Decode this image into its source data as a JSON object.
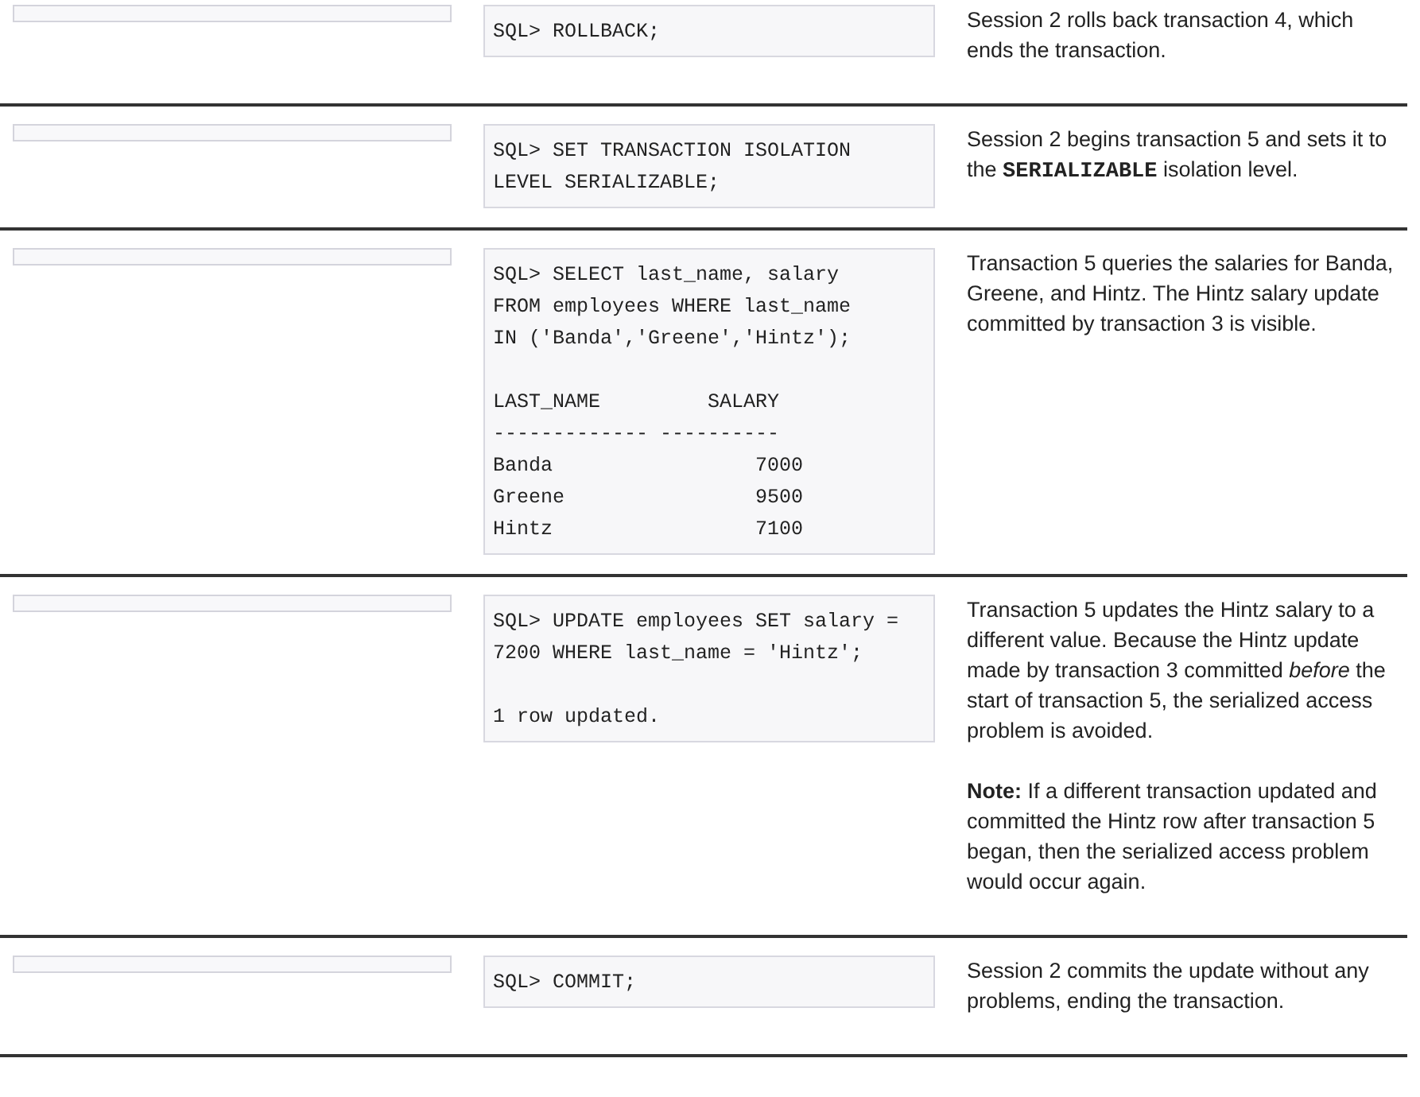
{
  "rows": [
    {
      "code": [
        [
          "SQL> ROLLBACK;"
        ]
      ],
      "description": [
        "Session 2 rolls back transaction 4, which ends the transaction."
      ]
    },
    {
      "code": [
        [
          "SQL> SET TRANSACTION ISOLATION",
          "LEVEL SERIALIZABLE;"
        ]
      ],
      "description": [
        "Session 2 begins transaction 5 and sets it to the **SERIALIZABLE** isolation level."
      ]
    },
    {
      "code": [
        [
          "SQL> SELECT last_name, salary",
          "FROM employees WHERE last_name",
          "IN ('Banda','Greene','Hintz');"
        ],
        [
          "LAST_NAME         SALARY",
          "------------- ----------",
          "Banda                 7000",
          "Greene                9500",
          "Hintz                 7100"
        ]
      ],
      "description": [
        "Transaction 5 queries the salaries for Banda, Greene, and Hintz. The Hintz salary update committed by transaction 3 is visible."
      ]
    },
    {
      "code": [
        [
          "SQL> UPDATE employees SET salary =",
          "7200 WHERE last_name = 'Hintz';"
        ],
        [
          "1 row updated."
        ]
      ],
      "description": [
        "Transaction 5 updates the Hintz salary to a different value. Because the Hintz update made by transaction 3 committed *before* the start of transaction 5, the serialized access problem is avoided.",
        "**Note:** If a different transaction updated and committed the Hintz row after transaction 5 began, then the serialized access problem would occur again."
      ]
    },
    {
      "code": [
        [
          "SQL> COMMIT;"
        ]
      ],
      "description": [
        "Session 2 commits the update without any problems, ending the transaction."
      ]
    }
  ]
}
